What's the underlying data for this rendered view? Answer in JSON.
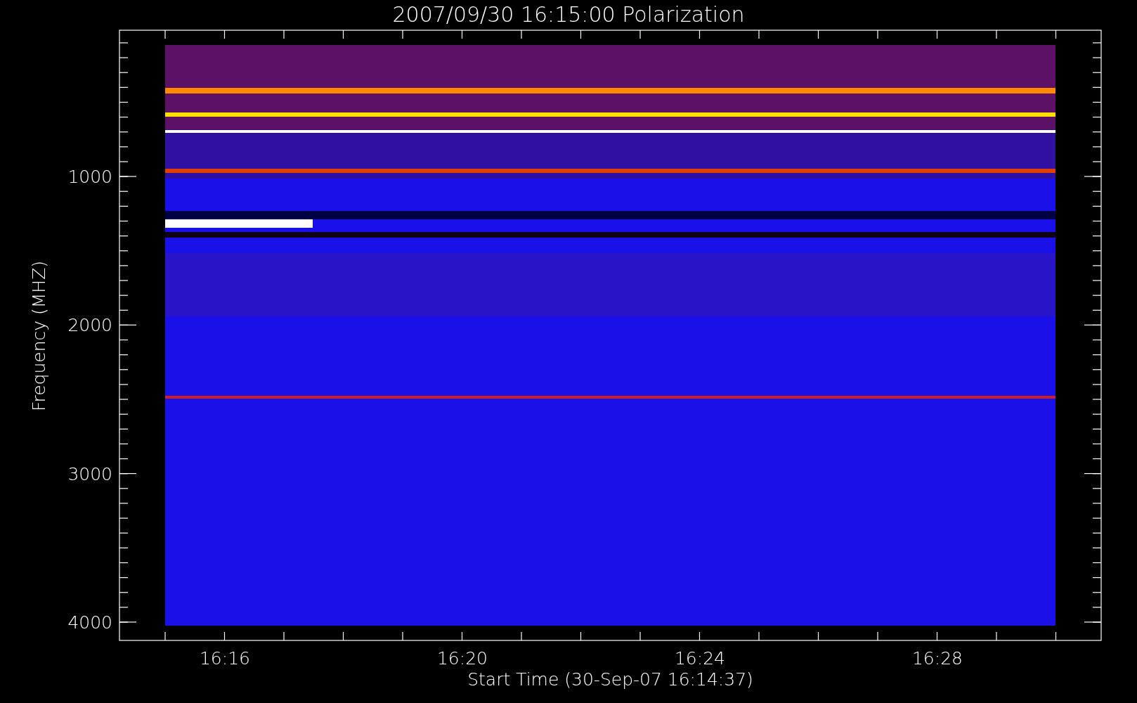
{
  "title": "2007/09/30 16:15:00 Polarization",
  "y_axis": {
    "label": "Frequency (MHZ)",
    "ticks": [
      "1000",
      "2000",
      "3000",
      "4000"
    ]
  },
  "x_axis": {
    "label": "Start Time (30-Sep-07 16:14:37)",
    "ticks": [
      "16:16",
      "16:20",
      "16:24",
      "16:28"
    ]
  }
}
